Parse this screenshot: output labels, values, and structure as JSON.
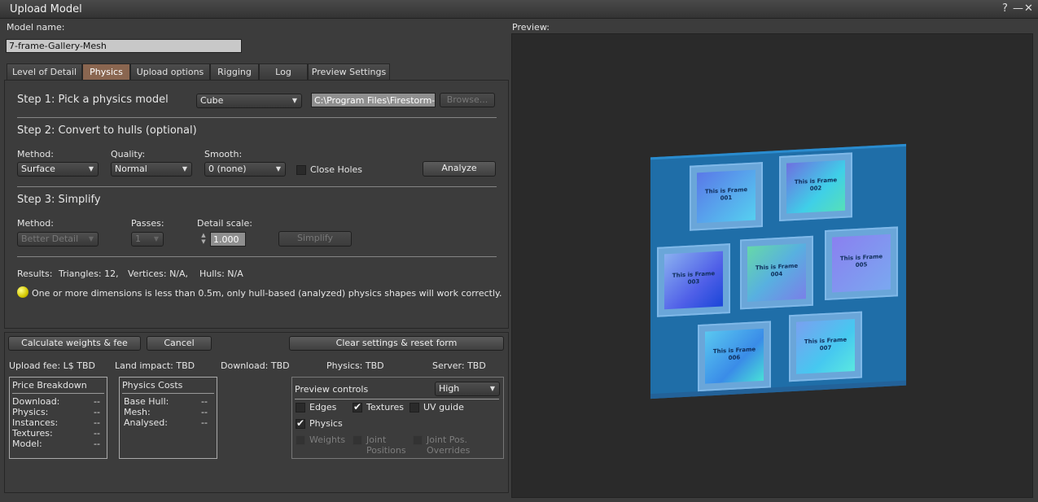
{
  "window": {
    "title": "Upload Model",
    "help_icon": "?",
    "minimize_icon": "—",
    "close_icon": "✕"
  },
  "model_name": {
    "label": "Model name:",
    "value": "7-frame-Gallery-Mesh"
  },
  "tabs": [
    {
      "label": "Level of Detail"
    },
    {
      "label": "Physics",
      "active": true
    },
    {
      "label": "Upload options"
    },
    {
      "label": "Rigging"
    },
    {
      "label": "Log"
    },
    {
      "label": "Preview Settings"
    }
  ],
  "step1": {
    "label": "Step 1: Pick a physics model",
    "model_select": "Cube",
    "file_path": "C:\\Program Files\\Firestorm-R",
    "browse_label": "Browse..."
  },
  "step2": {
    "label": "Step 2: Convert to hulls (optional)",
    "method_label": "Method:",
    "method_value": "Surface",
    "quality_label": "Quality:",
    "quality_value": "Normal",
    "smooth_label": "Smooth:",
    "smooth_value": "0 (none)",
    "close_holes_label": "Close Holes",
    "close_holes_checked": false,
    "analyze_label": "Analyze"
  },
  "step3": {
    "label": "Step 3: Simplify",
    "method_label": "Method:",
    "method_value": "Better Detail",
    "passes_label": "Passes:",
    "passes_value": "1",
    "detail_scale_label": "Detail scale:",
    "detail_scale_value": "1.000",
    "simplify_label": "Simplify"
  },
  "results": {
    "label": "Results:",
    "triangles": "Triangles: 12,",
    "vertices": "Vertices: N/A,",
    "hulls": "Hulls: N/A"
  },
  "warning": {
    "text": "One or more dimensions is less than 0.5m, only hull-based (analyzed) physics shapes will work correctly."
  },
  "buttons": {
    "calculate": "Calculate weights & fee",
    "cancel": "Cancel",
    "clear": "Clear settings & reset form"
  },
  "fees": {
    "upload_fee": "Upload fee: L$ TBD",
    "land_impact": "Land impact: TBD",
    "download": "Download: TBD",
    "physics": "Physics: TBD",
    "server": "Server: TBD"
  },
  "price_breakdown": {
    "title": "Price Breakdown",
    "rows": [
      {
        "label": "Download:",
        "value": "--"
      },
      {
        "label": "Physics:",
        "value": "--"
      },
      {
        "label": "Instances:",
        "value": "--"
      },
      {
        "label": "Textures:",
        "value": "--"
      },
      {
        "label": "Model:",
        "value": "--"
      }
    ]
  },
  "physics_costs": {
    "title": "Physics Costs",
    "rows": [
      {
        "label": "Base Hull:",
        "value": "--"
      },
      {
        "label": "Mesh:",
        "value": "--"
      },
      {
        "label": "Analysed:",
        "value": "--"
      }
    ]
  },
  "preview_controls": {
    "label": "Preview controls",
    "quality_value": "High",
    "edges_label": "Edges",
    "edges_checked": false,
    "textures_label": "Textures",
    "textures_checked": true,
    "uv_guide_label": "UV guide",
    "uv_guide_checked": false,
    "physics_label": "Physics",
    "physics_checked": true,
    "weights_label": "Weights",
    "joint_positions_label_1": "Joint",
    "joint_positions_label_2": "Positions",
    "joint_overrides_label_1": "Joint Pos.",
    "joint_overrides_label_2": "Overrides"
  },
  "preview": {
    "label": "Preview:",
    "frames": [
      {
        "caption_1": "This is Frame",
        "caption_2": "001"
      },
      {
        "caption_1": "This is Frame",
        "caption_2": "002"
      },
      {
        "caption_1": "This is Frame",
        "caption_2": "003"
      },
      {
        "caption_1": "This is Frame",
        "caption_2": "004"
      },
      {
        "caption_1": "This is Frame",
        "caption_2": "005"
      },
      {
        "caption_1": "This is Frame",
        "caption_2": "006"
      },
      {
        "caption_1": "This is Frame",
        "caption_2": "007"
      }
    ]
  },
  "colors": {
    "active_tab": "#8a6650",
    "window_bg": "#3c3c3c",
    "mesh_blue": "#1f6ea8"
  }
}
